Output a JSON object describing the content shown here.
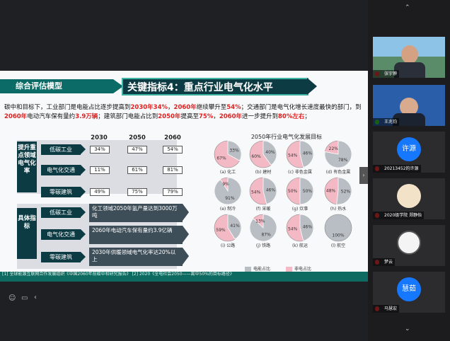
{
  "section_tag": "综合评估模型",
  "title": "关键指标4：重点行业电气化水平",
  "intro": {
    "p1": "碳中和目标下，工业部门是电能占比逐步提高到",
    "h1": "2030年34%",
    "p2": "，",
    "h2": "2060年",
    "p3": "继续攀升至",
    "h3": "54%",
    "p4": "；交通部门是电气化增长速度最快的部门，到",
    "h4": "2060年",
    "p5": "电动汽车保有量约",
    "h5": "3.9万辆",
    "p6": "；建筑部门电能占比到",
    "h6": "2050年",
    "p7": "提高至",
    "h7": "75%",
    "p8": "，",
    "h8": "2060年",
    "p9": "进一步提升到",
    "h9": "80%左右",
    "p10": "；"
  },
  "table": {
    "col_headers": [
      "2030",
      "2050",
      "2060"
    ],
    "left_label_top": "提升重点领域电气化率",
    "left_label_bottom": "具体指标",
    "rows_top": [
      {
        "label": "低碳工业",
        "values": [
          "34%",
          "47%",
          "54%"
        ]
      },
      {
        "label": "电气化交通",
        "values": [
          "11%",
          "61%",
          "81%"
        ]
      },
      {
        "label": "零碳建筑",
        "values": [
          "49%",
          "75%",
          "79%"
        ]
      }
    ],
    "rows_bottom": [
      {
        "label": "低碳工业",
        "text": "化工领域2050年氢产量达到3000万吨"
      },
      {
        "label": "电气化交通",
        "text": "2060年电动汽车保有量约3.9亿辆"
      },
      {
        "label": "零碳建筑",
        "text": "2030年供暖领域电气化率达20%以上"
      }
    ]
  },
  "chart_data": {
    "type": "pie",
    "title": "2050年行业电气化发展目标",
    "legend": [
      "电能占比",
      "非电占比"
    ],
    "colors": {
      "electric": "#b9bec4",
      "non_electric": "#f3b9c4"
    },
    "pies": [
      {
        "label": "(a) 化工",
        "values": [
          33,
          67
        ]
      },
      {
        "label": "(b) 建材",
        "values": [
          40,
          60
        ]
      },
      {
        "label": "(c) 非色金属",
        "values": [
          46,
          54
        ]
      },
      {
        "label": "(d) 有色金属",
        "values": [
          78,
          22
        ]
      },
      {
        "label": "(e) 制冷",
        "values": [
          91,
          9
        ]
      },
      {
        "label": "(f) 采暖",
        "values": [
          46,
          54
        ]
      },
      {
        "label": "(g) 炊事",
        "values": [
          50,
          50
        ]
      },
      {
        "label": "(h) 热水",
        "values": [
          52,
          48
        ]
      },
      {
        "label": "(i) 公路",
        "values": [
          41,
          59
        ]
      },
      {
        "label": "(j) 铁路",
        "values": [
          87,
          13
        ]
      },
      {
        "label": "(k) 航运",
        "values": [
          46,
          54
        ]
      },
      {
        "label": "(l) 航空",
        "values": [
          100,
          0
        ]
      }
    ]
  },
  "footer_text": "[1] 全球能源互联网合作发展组织《中国2060年前碳中和研究报告》 [2] 2020《全电社会2050——离中50%的目标路径》",
  "participants": [
    {
      "name": "张宇翀"
    },
    {
      "name": "王兆钧"
    },
    {
      "name": "20213452的许源",
      "avatar": "许源"
    },
    {
      "name": "2020级学院 郑静怡"
    },
    {
      "name": "梦云"
    },
    {
      "name": "马慧宏",
      "avatar": "慧茹"
    }
  ]
}
